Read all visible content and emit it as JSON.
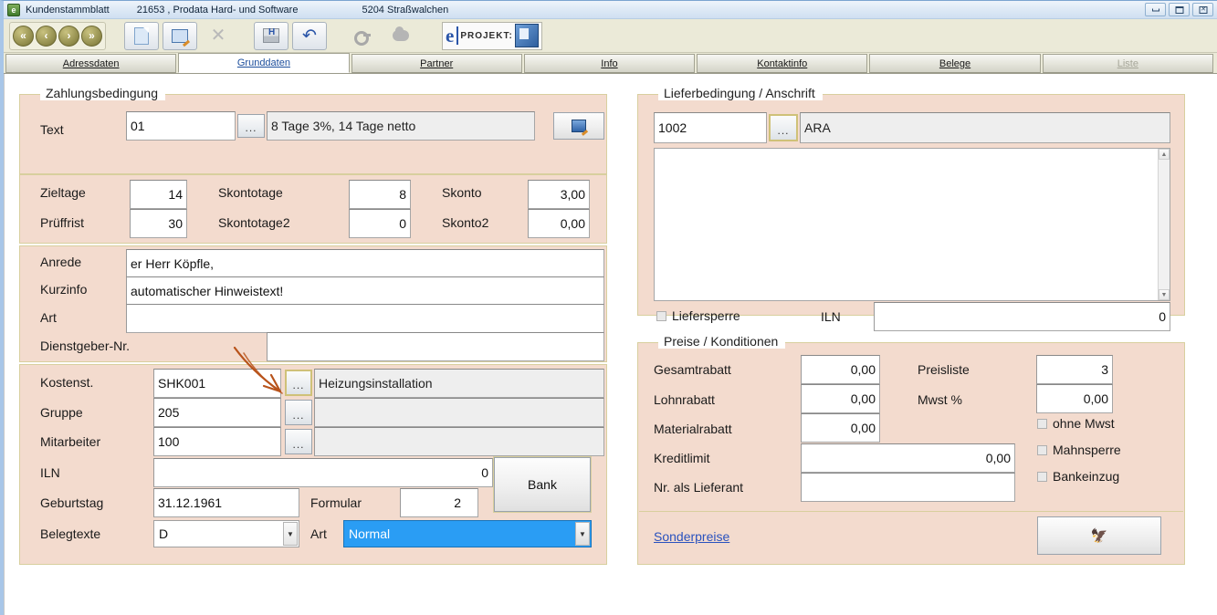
{
  "window": {
    "app_icon": "app-icon",
    "title": "Kundenstammblatt",
    "customer": "21653 , Prodata Hard- und Software",
    "city": "5204 Straßwalchen",
    "buttons": {
      "minimize": "minimize-icon",
      "maximize": "maximize-icon",
      "close": "close-icon"
    }
  },
  "toolbar": {
    "nav": [
      {
        "name": "first-record",
        "glyph": "«"
      },
      {
        "name": "previous-record",
        "glyph": "‹"
      },
      {
        "name": "next-record",
        "glyph": "›"
      },
      {
        "name": "last-record",
        "glyph": "»"
      }
    ],
    "actions": [
      {
        "name": "new-record-button",
        "icon": "document-icon"
      },
      {
        "name": "edit-record-button",
        "icon": "edit-document-icon"
      },
      {
        "name": "delete-record-button",
        "icon": "close-x-icon"
      },
      {
        "name": "save-record-button",
        "icon": "save-disk-icon"
      },
      {
        "name": "undo-button",
        "icon": "undo-arrow-icon"
      },
      {
        "name": "search-key-button",
        "icon": "key-icon"
      },
      {
        "name": "cloud-button",
        "icon": "cloud-icon"
      }
    ],
    "brand": {
      "e": "e",
      "text": "PROJEKT:",
      "logo": "eprojekt-logo-icon"
    }
  },
  "tabs": [
    {
      "label": "Adressdaten",
      "accel": "A",
      "state": "normal"
    },
    {
      "label": "Grunddaten",
      "accel": "G",
      "state": "active"
    },
    {
      "label": "Partner",
      "accel": "P",
      "state": "normal"
    },
    {
      "label": "Info",
      "accel": "I",
      "state": "normal"
    },
    {
      "label": "Kontaktinfo",
      "accel": "K",
      "state": "normal"
    },
    {
      "label": "Belege",
      "accel": "B",
      "state": "normal"
    },
    {
      "label": "Liste",
      "accel": "L",
      "state": "disabled"
    }
  ],
  "zahlungsbedingung": {
    "legend": "Zahlungsbedingung",
    "text_label": "Text",
    "text_code": "01",
    "text_lookup": "...",
    "text_description": "8 Tage 3%, 14 Tage netto",
    "text_button_icon": "document-edit-icon",
    "zieltage_label": "Zieltage",
    "zieltage_value": "14",
    "pruef_label": "Prüffrist",
    "pruef_value": "30",
    "skontotage_label": "Skontotage",
    "skontotage_value": "8",
    "skontotage2_label": "Skontotage2",
    "skontotage2_value": "0",
    "skonto_label": "Skonto",
    "skonto_value": "3,00",
    "skonto2_label": "Skonto2",
    "skonto2_value": "0,00"
  },
  "anrede_block": {
    "anrede_label": "Anrede",
    "anrede_value": "er Herr Köpfle,",
    "kurzinfo_label": "Kurzinfo",
    "kurzinfo_value": "automatischer Hinweistext!",
    "art_label": "Art",
    "art_value": "",
    "dienstgeber_label": "Dienstgeber-Nr.",
    "dienstgeber_value": ""
  },
  "kosten_block": {
    "kostenst_label": "Kostenst.",
    "kostenst_value": "SHK001",
    "kostenst_lookup": "...",
    "kostenst_desc": "Heizungsinstallation",
    "gruppe_label": "Gruppe",
    "gruppe_value": "205",
    "gruppe_lookup": "...",
    "gruppe_desc": "",
    "mitarbeiter_label": "Mitarbeiter",
    "mitarbeiter_value": "100",
    "mitarbeiter_lookup": "...",
    "mitarbeiter_desc": "",
    "iln_label": "ILN",
    "iln_value": "0",
    "bank_button": "Bank",
    "geburtstag_label": "Geburtstag",
    "geburtstag_value": "31.12.1961",
    "formular_label": "Formular",
    "formular_value": "2",
    "belegtexte_label": "Belegtexte",
    "belegtexte_value": "D",
    "art_label": "Art",
    "art_value": "Normal"
  },
  "lieferbedingung": {
    "legend": "Lieferbedingung / Anschrift",
    "code": "1002",
    "lookup": "...",
    "description": "ARA",
    "address_memo": "",
    "liefersperre_label": "Liefersperre",
    "liefersperre_checked": false,
    "iln_label": "ILN",
    "iln_value": "0"
  },
  "preise": {
    "legend": "Preise / Konditionen",
    "gesamtrabatt_label": "Gesamtrabatt",
    "gesamtrabatt_value": "0,00",
    "lohnrabatt_label": "Lohnrabatt",
    "lohnrabatt_value": "0,00",
    "materialrabatt_label": "Materialrabatt",
    "materialrabatt_value": "0,00",
    "kreditlimit_label": "Kreditlimit",
    "kreditlimit_value": "0,00",
    "lieferant_label": "Nr. als Lieferant",
    "lieferant_value": "",
    "preisliste_label": "Preisliste",
    "preisliste_value": "3",
    "mwst_label": "Mwst %",
    "mwst_value": "0,00",
    "ohne_mwst_label": "ohne Mwst",
    "mahnsperre_label": "Mahnsperre",
    "bankeinzug_label": "Bankeinzug",
    "sonderpreise_link": "Sonderpreise",
    "eagle_button_icon": "eagle-crest-icon",
    "eagle_glyph": "🦅"
  },
  "annotation": {
    "arrow_color": "#b8531b",
    "name": "red-arrow-annotation"
  },
  "colors": {
    "panel_bg": "#f3dbce",
    "panel_border": "#d8cf9e",
    "toolbar_bg": "#ebead8",
    "selection_blue": "#2a9df4",
    "link_blue": "#2a52be"
  }
}
